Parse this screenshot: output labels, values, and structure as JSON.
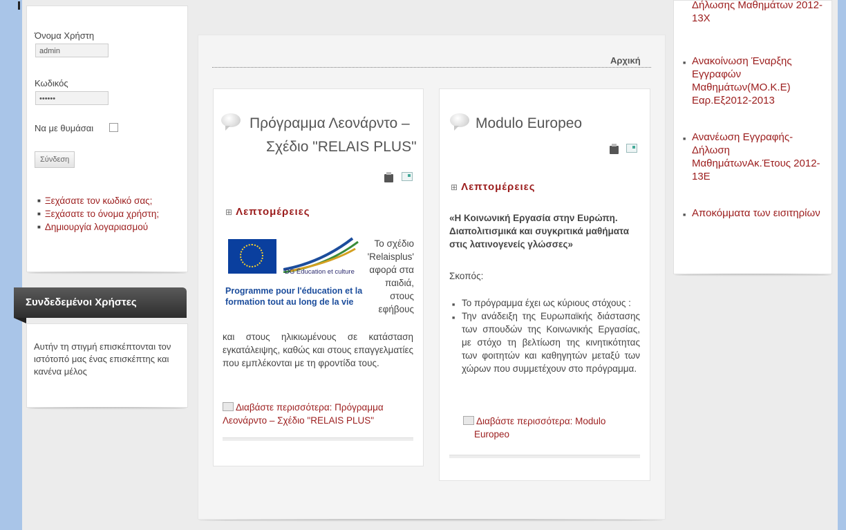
{
  "login": {
    "username_label": "Όνομα Χρήστη",
    "username_value": "admin",
    "password_label": "Κωδικός",
    "password_value": "••••••",
    "remember_label": "Να με θυμάσαι",
    "submit_label": "Σύνδεση",
    "links": [
      "Ξεχάσατε τον κωδικό σας;",
      "Ξεχάσατε το όνομα χρήστη;",
      "Δημιουργία λογαριασμού"
    ]
  },
  "online": {
    "title": "Συνδεδεμένοι Χρήστες",
    "text": "Αυτήν τη στιγμή επισκέπτονται τον ιστότοπό μας ένας επισκέπτης και κανένα μέλος"
  },
  "breadcrumb": "Αρχική",
  "article1": {
    "title_line1": "Πρόγραμμα Λεονάρντο –",
    "title_line2": "Σχέδιο \"RELAIS PLUS\"",
    "details_label": "Λεπτομέρειες",
    "logo_dg": "DG Éducation et culture",
    "logo_program": "Programme pour l'éducation et la formation tout au long de la vie",
    "side_text": "Το σχέδιο 'Relaisplus' αφορά στα παιδιά, στους εφήβους",
    "body": "και στους ηλικιωμένους σε κατάσταση εγκατάλειψης, καθώς και στους επαγγελματίες που εμπλέκονται με τη φροντίδα τους.",
    "read_more": "Διαβάστε περισσότερα: Πρόγραμμα Λεονάρντο – Σχέδιο \"RELAIS PLUS\""
  },
  "article2": {
    "title": "Modulo Europeo",
    "details_label": "Λεπτομέρειες",
    "subtitle": "«Η Κοινωνική Εργασία στην Ευρώπη. Διαπολιτισμικά και συγκριτικά μαθήματα στις λατινογενείς γλώσσες»",
    "aim_label": "Σκοπός:",
    "bullets": [
      "Το πρόγραμμα έχει ως κύριους στόχους :",
      "Την ανάδειξη της Ευρωπαϊκής διάστασης των σπουδών της Κοινωνικής Εργασίας, με στόχο τη βελτίωση της κινητικότητας των φοιτητών και καθηγητών μεταξύ των χώρων που συμμετέχουν στο πρόγραμμα."
    ],
    "read_more_1": "Διαβάστε περισσότερα: Modulo",
    "read_more_2": "Europeo"
  },
  "announcements": {
    "partial": "Δήλωσης Μαθημάτων 2012-13Χ",
    "items": [
      "Ανακοίνωση Έναρξης Εγγραφών Μαθημάτων(ΜΟ.Κ.Ε) Εαρ.Εξ2012-2013",
      "Ανανέωση Εγγραφής-Δήλωση ΜαθημάτωνΑκ.Έτους 2012-13Ε",
      "Αποκόμματα των εισιτηρίων"
    ]
  }
}
